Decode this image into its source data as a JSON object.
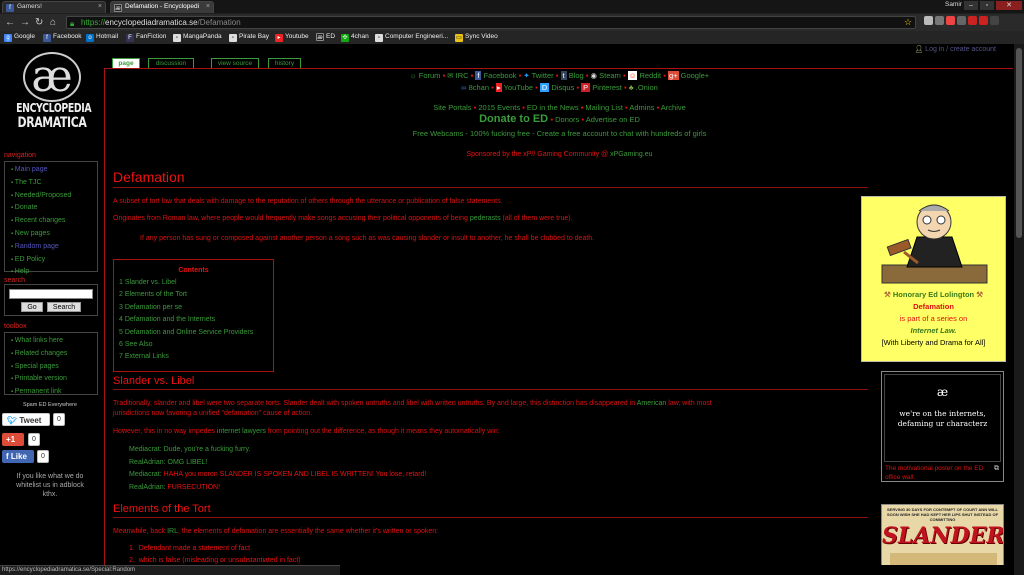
{
  "browser": {
    "tabs": [
      {
        "label": "Gamers!",
        "icon": "facebook-icon"
      },
      {
        "label": "Defamation - Encyclopedi",
        "icon": "ae-icon"
      }
    ],
    "user": "Samir",
    "url_scheme": "https://",
    "url_host": "encyclopediadramatica.se",
    "url_path": "/Defamation",
    "bookmarks": [
      "Google",
      "Facebook",
      "Hotmail",
      "FanFiction",
      "MangaPanda",
      "Pirate Bay",
      "Youtube",
      "ED",
      "4chan",
      "Computer Engineeri...",
      "Sync Video"
    ],
    "status_url": "https://encyclopediadramatica.se/Special:Random"
  },
  "logo": {
    "glyph": "æ",
    "line1": "ENCYCLOPEDIA",
    "line2": "DRAMATICA"
  },
  "sidebar": {
    "navigation_title": "navigation",
    "navigation": [
      "Main page",
      "The TJC",
      "Needed/Proposed",
      "Donate",
      "Recent changes",
      "New pages",
      "Random page",
      "ED Policy",
      "Help"
    ],
    "search_title": "search",
    "go_label": "Go",
    "search_label": "Search",
    "toolbox_title": "toolbox",
    "toolbox": [
      "What links here",
      "Related changes",
      "Special pages",
      "Printable version",
      "Permanent link"
    ],
    "spam_caption": "Spam ED Everywhere",
    "tweet_label": "Tweet",
    "tweet_count": "0",
    "gplus_label": "+1",
    "gplus_count": "0",
    "like_label": "Like",
    "like_count": "0",
    "adblock_note": "If you like what we do whitelist us in adblock kthx."
  },
  "login_link": "Log in / create account",
  "page_tabs": [
    "page",
    "discussion",
    "view source",
    "history"
  ],
  "top_links": {
    "row1": [
      "Forum",
      "IRC",
      "Facebook",
      "Twitter",
      "Blog",
      "Steam",
      "Reddit",
      "Google+"
    ],
    "row2": [
      "8chan",
      "YouTube",
      "Disqus",
      "Pinterest",
      ".Onion"
    ],
    "row3": [
      "Site Portals",
      "2015 Events",
      "ED in the News",
      "Mailing List",
      "Admins",
      "Archive"
    ],
    "donate": "Donate to ED",
    "donors": "Donors",
    "advertise": "Advertise on ED",
    "webcams": "Free Webcams - 100% fucking free - Create a free account to chat with hundreds of girls",
    "sponsor_text": "Sponsored by the xP// Gaming Community @",
    "sponsor_link": "xPGaming.eu"
  },
  "article": {
    "title": "Defamation",
    "intro1": "A subset of tort law that deals with damage to the reputation of others through the utterance or publication of false statements.",
    "intro2_a": "Originates from Roman law, where people would frequently make songs accusing their political opponents of being",
    "intro2_link": "pederasts",
    "intro2_b": "(all of them were true).",
    "quote": "If any person has sung or composed against another person a song such as was causing slander or insult to another, he shall be clubbed to death.",
    "contents_title": "Contents",
    "toc": [
      {
        "n": "1",
        "t": "Slander vs. Libel"
      },
      {
        "n": "2",
        "t": "Elements of the Tort"
      },
      {
        "n": "3",
        "t": "Defamation per se"
      },
      {
        "n": "4",
        "t": "Defamation and the Internets"
      },
      {
        "n": "5",
        "t": "Defamation and Online Service Providers"
      },
      {
        "n": "6",
        "t": "See Also"
      },
      {
        "n": "7",
        "t": "External Links"
      }
    ],
    "s1_title": "Slander vs. Libel",
    "s1_p1a": "Traditionally, slander and libel were two separate torts. Slander dealt with spoken untruths and libel with written untruths. By and large, this distinction has disappeared in",
    "s1_p1_link": "American",
    "s1_p1b": "law, with most",
    "s1_p1c": "jurisdictions now favoring a unified \"defamation\" cause of action.",
    "s1_p2a": "However, this in no way impedes",
    "s1_p2_link": "internet lawyers",
    "s1_p2b": "from pointing out the difference, as though it means they automatically win:",
    "dialog": [
      {
        "who": "Mediacrat:",
        "text": "Dude, you're a fucking furry.",
        "color": "green"
      },
      {
        "who": "RealAdrian:",
        "text": "OMG LIBEL!",
        "color": "green"
      },
      {
        "who": "Mediacrat:",
        "text": "HAHA you moron SLANDER IS SPOKEN AND LIBEL IS WRITTEN! You lose, retard!",
        "color": "red"
      },
      {
        "who": "RealAdrian:",
        "text": "FURSECUTION!",
        "color": "red"
      }
    ],
    "s2_title": "Elements of the Tort",
    "s2_p1a": "Meanwhile, back",
    "s2_p1_link": "IRL",
    "s2_p1b": ", the elements of defamation are essentially the same whether it's written or spoken:",
    "s2_list": [
      "Defendant made a statement of fact",
      "which is false (misleading or unsubstantiated in fact)"
    ]
  },
  "infobox": {
    "line1": "Honorary Ed Lolington",
    "line2": "Defamation",
    "line3": "is part of a series on",
    "line4": "Internet Law.",
    "line5": "[With Liberty and Drama for All]"
  },
  "poster": {
    "glyph": "æ",
    "text": "we're on the internets, defaming ur characterz",
    "caption": "The motivational poster on the ED office wall."
  },
  "slander_image": {
    "top_text": "SERVING 30 DAYS FOR CONTEMPT OF COURT ANN WILL SOON WISH SHE HAD KEPT HER LIPS SHUT INSTEAD OF COMMITTING",
    "word": "SLANDER"
  },
  "colors": {
    "red": "#e11111",
    "green": "#3a9b3a",
    "bg": "#000000",
    "infobox": "#ffff66"
  }
}
